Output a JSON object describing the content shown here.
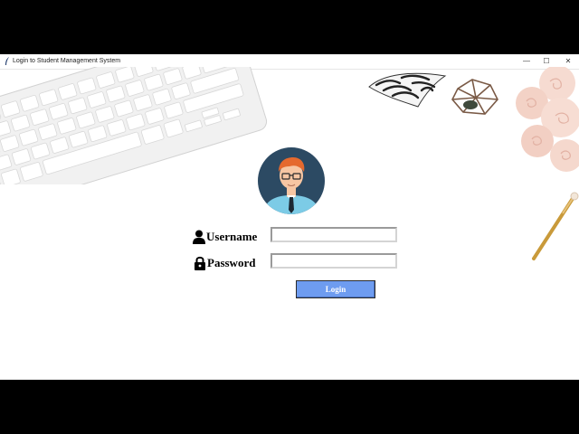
{
  "window": {
    "title": "Login to Student Management System",
    "controls": {
      "minimize": "—",
      "maximize": "☐",
      "close": "✕"
    }
  },
  "form": {
    "username_label": "Username",
    "username_value": "",
    "password_label": "Password",
    "password_value": "",
    "login_label": "Login"
  },
  "icons": {
    "app": "feather-icon",
    "username": "user-icon",
    "password": "lock-icon",
    "avatar": "student-avatar"
  },
  "colors": {
    "login_button": "#6e9cf0",
    "avatar_background": "#2c4a63"
  }
}
